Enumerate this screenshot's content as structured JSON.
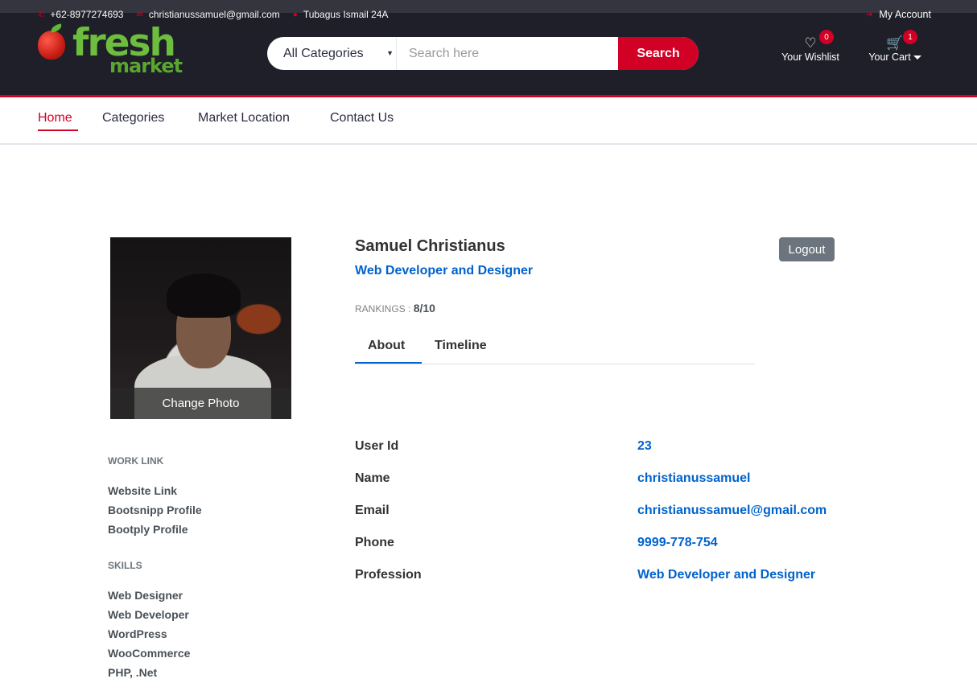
{
  "header": {
    "phone": "+62-8977274693",
    "email": "christianussamuel@gmail.com",
    "address": "Tubagus Ismail 24A",
    "account_label": "My Account",
    "logo_text_1": "fresh",
    "logo_text_2": "market",
    "category_select": "All Categories",
    "search_placeholder": "Search here",
    "search_button": "Search",
    "wishlist_label": "Your Wishlist",
    "wishlist_qty": "0",
    "cart_label": "Your Cart",
    "cart_qty": "1"
  },
  "nav": {
    "items": [
      {
        "label": "Home"
      },
      {
        "label": "Categories"
      },
      {
        "label": "Market Location"
      },
      {
        "label": "Contact Us"
      }
    ]
  },
  "profile": {
    "change_photo": "Change Photo",
    "name": "Samuel Christianus",
    "profession": "Web Developer and Designer",
    "rankings_label": "RANKINGS :",
    "rankings_value": "8/10",
    "logout": "Logout",
    "tabs": [
      {
        "label": "About"
      },
      {
        "label": "Timeline"
      }
    ],
    "work_link_heading": "WORK LINK",
    "work_links": [
      "Website Link",
      "Bootsnipp Profile",
      "Bootply Profile"
    ],
    "skills_heading": "SKILLS",
    "skills": [
      "Web Designer",
      "Web Developer",
      "WordPress",
      "WooCommerce",
      "PHP, .Net"
    ],
    "about": [
      {
        "key": "User Id",
        "value": "23"
      },
      {
        "key": "Name",
        "value": "christianussamuel"
      },
      {
        "key": "Email",
        "value": "christianussamuel@gmail.com"
      },
      {
        "key": "Phone",
        "value": "9999-778-754"
      },
      {
        "key": "Profession",
        "value": "Web Developer and Designer"
      }
    ]
  },
  "colors": {
    "accent": "#d10024",
    "header_bg": "#1e1f29",
    "link_blue": "#0062cc"
  }
}
